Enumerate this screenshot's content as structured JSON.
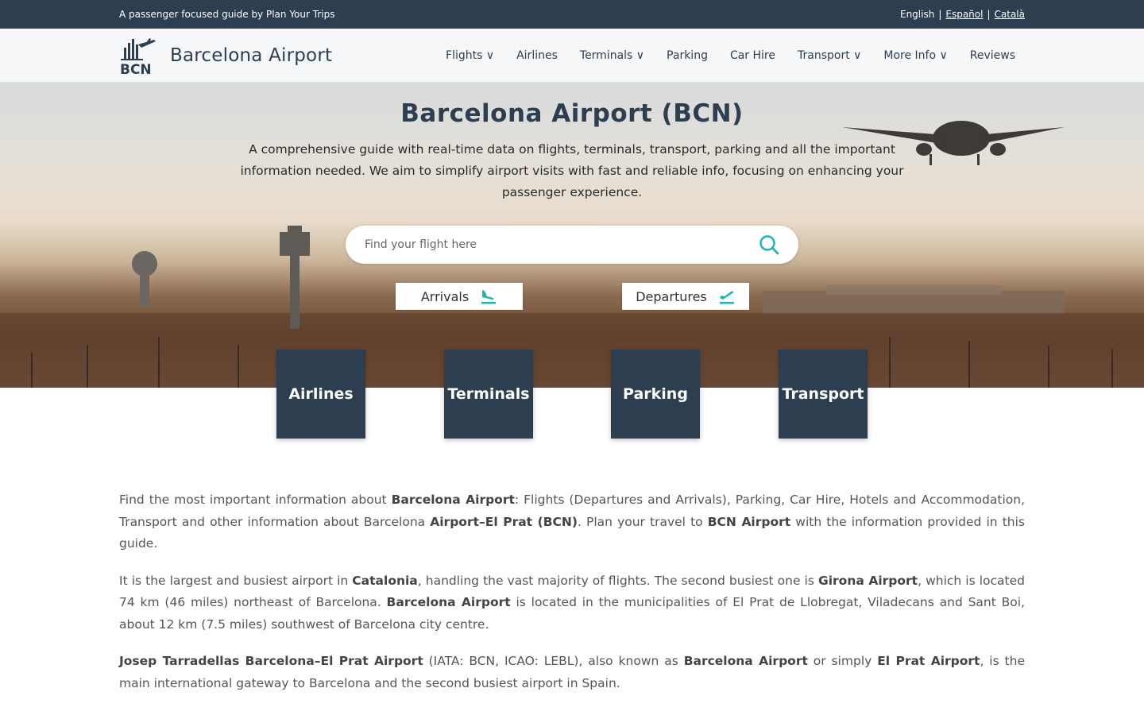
{
  "topbar": {
    "tagline": "A passenger focused guide by Plan Your Trips",
    "lang_current": "English",
    "lang_es": "Español",
    "lang_ca": "Català",
    "separator": "|"
  },
  "header": {
    "logo_text": "BCN",
    "brand": "Barcelona Airport",
    "menu": [
      {
        "label": "Flights ∨"
      },
      {
        "label": "Airlines"
      },
      {
        "label": "Terminals ∨"
      },
      {
        "label": "Parking"
      },
      {
        "label": "Car Hire"
      },
      {
        "label": "Transport ∨"
      },
      {
        "label": "More Info ∨"
      },
      {
        "label": "Reviews"
      }
    ]
  },
  "hero": {
    "title": "Barcelona Airport (BCN)",
    "description": "A comprehensive guide with real-time data on flights, terminals, transport, parking and all the important information needed. We aim to simplify airport visits with fast and reliable info, focusing on enhancing your passenger experience.",
    "search_placeholder": "Find your flight here",
    "arrivals_label": "Arrivals",
    "departures_label": "Departures"
  },
  "tiles": [
    {
      "label": "Airlines"
    },
    {
      "label": "Terminals"
    },
    {
      "label": "Parking"
    },
    {
      "label": "Transport"
    }
  ],
  "intro": {
    "p1": [
      {
        "t": "Find the most important information about ",
        "b": false
      },
      {
        "t": "Barcelona Airport",
        "b": true
      },
      {
        "t": ": Flights (Departures and Arrivals), Parking, Car Hire, Hotels and Accommodation, Transport and other information about Barcelona ",
        "b": false
      },
      {
        "t": "Airport–El Prat (BCN)",
        "b": true
      },
      {
        "t": ". Plan your travel to ",
        "b": false
      },
      {
        "t": "BCN Airport",
        "b": true
      },
      {
        "t": " with the information provided in this guide.",
        "b": false
      }
    ],
    "p2": [
      {
        "t": "It is the largest and busiest airport in ",
        "b": false
      },
      {
        "t": "Catalonia",
        "b": true
      },
      {
        "t": ", handling the vast majority of flights. The second busiest one is ",
        "b": false
      },
      {
        "t": "Girona Airport",
        "b": true
      },
      {
        "t": ", which is located 74 km (46 miles) northeast of Barcelona. ",
        "b": false
      },
      {
        "t": "Barcelona Airport",
        "b": true
      },
      {
        "t": " is located in the municipalities of El Prat de Llobregat, Viladecans and Sant Boi, about 12 km (7.5 miles) southwest of Barcelona city centre.",
        "b": false
      }
    ],
    "p3": [
      {
        "t": "Josep Tarradellas Barcelona–El Prat Airport",
        "b": true
      },
      {
        "t": " (IATA: BCN, ICAO: LEBL), also known as ",
        "b": false
      },
      {
        "t": "Barcelona Airport",
        "b": true
      },
      {
        "t": " or simply ",
        "b": false
      },
      {
        "t": "El Prat Airport",
        "b": true
      },
      {
        "t": ", is the main international gateway to Barcelona and the second busiest airport in Spain.",
        "b": false
      }
    ]
  },
  "colors": {
    "primary": "#2c3e50",
    "accent": "#1fb3b3",
    "navbar_bg": "#f6f7f8"
  },
  "icons": {
    "logo": "bcn-logo-icon",
    "search": "search-icon",
    "arrivals": "plane-landing-icon",
    "departures": "plane-takeoff-icon"
  }
}
